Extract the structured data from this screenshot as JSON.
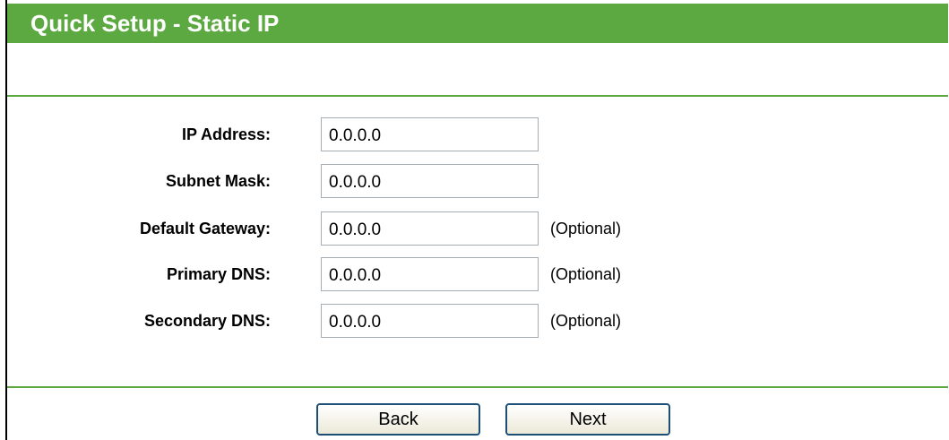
{
  "header": {
    "title": "Quick Setup - Static IP"
  },
  "fields": [
    {
      "label": "IP Address:",
      "value": "0.0.0.0",
      "note": ""
    },
    {
      "label": "Subnet Mask:",
      "value": "0.0.0.0",
      "note": ""
    },
    {
      "label": "Default Gateway:",
      "value": "0.0.0.0",
      "note": "(Optional)"
    },
    {
      "label": "Primary DNS:",
      "value": "0.0.0.0",
      "note": "(Optional)"
    },
    {
      "label": "Secondary DNS:",
      "value": "0.0.0.0",
      "note": "(Optional)"
    }
  ],
  "buttons": {
    "back_label": "Back",
    "next_label": "Next"
  },
  "colors": {
    "accent": "#5ca941",
    "title_text": "#ffffff"
  }
}
